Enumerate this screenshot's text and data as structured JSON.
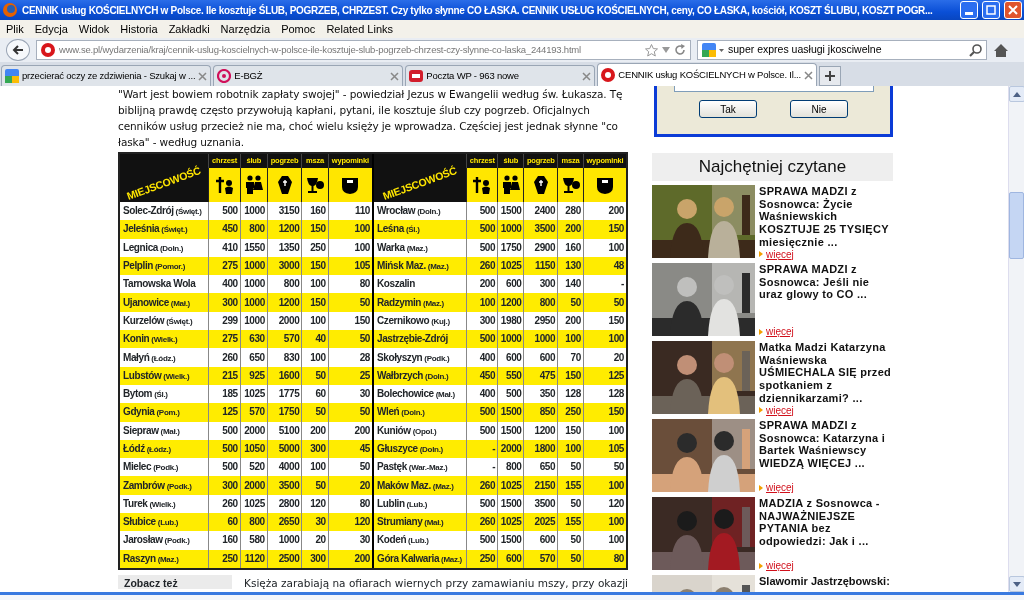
{
  "window": {
    "title": "CENNIK usług KOŚCIELNYCH w Polsce. Ile kosztuje ŚLUB, POGRZEB, CHRZEST. Czy tylko słynne CO ŁASKA. CENNIK USŁUG KOŚCIELNYCH, ceny, CO ŁASKA, kościół, KOSZT ŚLUBU, KOSZT POGR..."
  },
  "menu": [
    "Plik",
    "Edycja",
    "Widok",
    "Historia",
    "Zakładki",
    "Narzędzia",
    "Pomoc",
    "Related Links"
  ],
  "address": "www.se.pl/wydarzenia/kraj/cennik-uslug-koscielnych-w-polsce-ile-kosztuje-slub-pogrzeb-chrzest-czy-slynne-co-laska_244193.html",
  "search": {
    "value": "super expres uasługi jkosciwelne"
  },
  "tabs": [
    {
      "title": "przecierać oczy ze zdziwienia - Szukaj w ...",
      "kind": "google",
      "selected": false
    },
    {
      "title": "E-BGŻ",
      "kind": "ebgz",
      "selected": false
    },
    {
      "title": "Poczta WP - 963 nowe",
      "kind": "wp",
      "selected": false
    },
    {
      "title": "CENNIK usług KOŚCIELNYCH w Polsce. Il...",
      "kind": "se",
      "selected": true
    }
  ],
  "article": {
    "intro": "\"Wart jest bowiem robotnik zapłaty swojej\" - powiedział Jezus w Ewangelii według św. Łukasza. Tę biblijną prawdę często przywołują kapłani, pytani, ile kosztuje ślub czy pogrzeb. Oficjalnych cenników usług przecież nie ma, choć wielu księży je wprowadza. Częściej jest jednak słynne \"co łaska\" - według uznania.",
    "tables": [
      {
        "corner": "MIEJSCOWOŚĆ",
        "columns": [
          "chrzest",
          "ślub",
          "pogrzeb",
          "msza",
          "wypominki"
        ],
        "rows": [
          {
            "place": "Solec-Zdrój",
            "region": "(Święt.)",
            "values": [
              "500",
              "1000",
              "3150",
              "160",
              "110"
            ]
          },
          {
            "place": "Jeleśnia",
            "region": "(Święt.)",
            "values": [
              "450",
              "800",
              "1200",
              "150",
              "100"
            ]
          },
          {
            "place": "Legnica",
            "region": "(Doln.)",
            "values": [
              "410",
              "1550",
              "1350",
              "250",
              "100"
            ]
          },
          {
            "place": "Pelplin",
            "region": "(Pomor.)",
            "values": [
              "275",
              "1000",
              "3000",
              "150",
              "105"
            ]
          },
          {
            "place": "Tarnowska Wola",
            "values": [
              "400",
              "1000",
              "800",
              "100",
              "80"
            ]
          },
          {
            "place": "Ujanowice",
            "region": "(Mał.)",
            "values": [
              "300",
              "1000",
              "1200",
              "150",
              "50"
            ]
          },
          {
            "place": "Kurzelów",
            "region": "(Święt.)",
            "values": [
              "299",
              "1000",
              "2000",
              "100",
              "150"
            ]
          },
          {
            "place": "Konin",
            "region": "(Wielk.)",
            "values": [
              "275",
              "630",
              "570",
              "40",
              "50"
            ]
          },
          {
            "place": "Małyń",
            "region": "(Łódz.)",
            "values": [
              "260",
              "650",
              "830",
              "100",
              "28"
            ]
          },
          {
            "place": "Lubstów",
            "region": "(Wielk.)",
            "values": [
              "215",
              "925",
              "1600",
              "50",
              "25"
            ]
          },
          {
            "place": "Bytom",
            "region": "(Śl.)",
            "values": [
              "185",
              "1025",
              "1775",
              "60",
              "30"
            ]
          },
          {
            "place": "Gdynia",
            "region": "(Pom.)",
            "values": [
              "125",
              "570",
              "1750",
              "50",
              "50"
            ]
          },
          {
            "place": "Siepraw",
            "region": "(Mał.)",
            "values": [
              "500",
              "2000",
              "5100",
              "200",
              "200"
            ]
          },
          {
            "place": "Łódź",
            "region": "(Łódz.)",
            "values": [
              "500",
              "1050",
              "5000",
              "300",
              "45"
            ]
          },
          {
            "place": "Mielec",
            "region": "(Podk.)",
            "values": [
              "500",
              "520",
              "4000",
              "100",
              "50"
            ]
          },
          {
            "place": "Zambrów",
            "region": "(Podk.)",
            "values": [
              "300",
              "2000",
              "3500",
              "50",
              "20"
            ]
          },
          {
            "place": "Turek",
            "region": "(Wielk.)",
            "values": [
              "260",
              "1025",
              "2800",
              "120",
              "80"
            ]
          },
          {
            "place": "Słubice",
            "region": "(Lub.)",
            "values": [
              "60",
              "800",
              "2650",
              "30",
              "120"
            ]
          },
          {
            "place": "Jarosław",
            "region": "(Podk.)",
            "values": [
              "160",
              "580",
              "1000",
              "20",
              "30"
            ]
          },
          {
            "place": "Raszyn",
            "region": "(Maz.)",
            "values": [
              "250",
              "1120",
              "2500",
              "300",
              "200"
            ]
          }
        ]
      },
      {
        "corner": "MIEJSCOWOŚĆ",
        "columns": [
          "chrzest",
          "ślub",
          "pogrzeb",
          "msza",
          "wypominki"
        ],
        "rows": [
          {
            "place": "Wrocław",
            "region": "(Doln.)",
            "values": [
              "500",
              "1500",
              "2400",
              "280",
              "200"
            ]
          },
          {
            "place": "Leśna",
            "region": "(Śl.)",
            "values": [
              "500",
              "1000",
              "3500",
              "200",
              "150"
            ]
          },
          {
            "place": "Warka",
            "region": "(Maz.)",
            "values": [
              "500",
              "1750",
              "2900",
              "160",
              "100"
            ]
          },
          {
            "place": "Mińsk Maz.",
            "region": "(Maz.)",
            "values": [
              "260",
              "1025",
              "1150",
              "130",
              "48"
            ]
          },
          {
            "place": "Koszalin",
            "values": [
              "200",
              "600",
              "300",
              "140",
              "-"
            ]
          },
          {
            "place": "Radzymin",
            "region": "(Maz.)",
            "values": [
              "100",
              "1200",
              "800",
              "50",
              "50"
            ]
          },
          {
            "place": "Czernikowo",
            "region": "(Kuj.)",
            "values": [
              "300",
              "1980",
              "2950",
              "200",
              "150"
            ]
          },
          {
            "place": "Jastrzębie-Zdrój",
            "values": [
              "500",
              "1000",
              "1000",
              "100",
              "100"
            ]
          },
          {
            "place": "Skołyszyn",
            "region": "(Podk.)",
            "values": [
              "400",
              "600",
              "600",
              "70",
              "20"
            ]
          },
          {
            "place": "Wałbrzych",
            "region": "(Doln.)",
            "values": [
              "450",
              "550",
              "475",
              "150",
              "125"
            ]
          },
          {
            "place": "Bolechowice",
            "region": "(Mał.)",
            "values": [
              "400",
              "500",
              "350",
              "128",
              "128"
            ]
          },
          {
            "place": "Wleń",
            "region": "(Doln.)",
            "values": [
              "500",
              "1500",
              "850",
              "250",
              "150"
            ]
          },
          {
            "place": "Kuniów",
            "region": "(Opol.)",
            "values": [
              "500",
              "1500",
              "1200",
              "150",
              "100"
            ]
          },
          {
            "place": "Głuszyce",
            "region": "(Doln.)",
            "values": [
              "-",
              "2000",
              "1800",
              "100",
              "105"
            ]
          },
          {
            "place": "Pastęk",
            "region": "(War.-Maz.)",
            "values": [
              "-",
              "800",
              "650",
              "50",
              "50"
            ]
          },
          {
            "place": "Maków Maz.",
            "region": "(Maz.)",
            "values": [
              "260",
              "1025",
              "2150",
              "155",
              "100"
            ]
          },
          {
            "place": "Lublin",
            "region": "(Lub.)",
            "values": [
              "500",
              "1500",
              "3500",
              "50",
              "120"
            ]
          },
          {
            "place": "Strumiany",
            "region": "(Mał.)",
            "values": [
              "260",
              "1025",
              "2025",
              "155",
              "100"
            ]
          },
          {
            "place": "Kodeń",
            "region": "(Lub.)",
            "values": [
              "500",
              "1500",
              "600",
              "50",
              "100"
            ]
          },
          {
            "place": "Góra Kalwaria",
            "region": "(Maz.)",
            "values": [
              "250",
              "600",
              "570",
              "50",
              "80"
            ]
          }
        ]
      }
    ],
    "see_also": "Zobacz też",
    "body": "Księża zarabiają na ofiarach wiernych przy zamawianiu mszy, przy okazji"
  },
  "dialog": {
    "buttons": [
      "Tak",
      "Nie"
    ]
  },
  "most_read": {
    "heading": "Najchętniej czytane",
    "articles": [
      {
        "title": "SPRAWA MADZI z Sosnowca: Życie Waśniewskich KOSZTUJE 25 TYSIĘCY miesięcznie ...",
        "more": "więcej"
      },
      {
        "title": "SPRAWA MADZI z Sosnowca: Jeśli nie uraz glowy to CO ...",
        "more": "więcej"
      },
      {
        "title": "Matka Madzi Katarzyna Waśniewska UŚMIECHALA SIĘ przed spotkaniem z dziennikarzami? ...",
        "more": "więcej"
      },
      {
        "title": "SPRAWA MADZI z Sosnowca: Katarzyna i Bartek Waśniewscy WIEDZĄ WIĘCEJ ...",
        "more": "więcej"
      },
      {
        "title": "MADZIA z Sosnowca - NAJWAŻNIEJSZE PYTANIA bez odpowiedzi: Jak i ...",
        "more": "więcej"
      },
      {
        "title": "Slawomir Jastrzębowski:"
      }
    ]
  }
}
